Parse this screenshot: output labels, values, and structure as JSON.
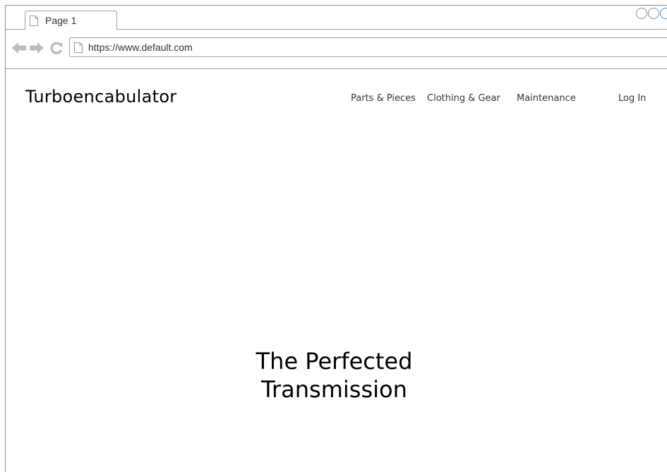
{
  "browser": {
    "tab_title": "Page 1",
    "url": "https://www.default.com",
    "icons": {
      "back": "arrow-left-icon",
      "forward": "arrow-right-icon",
      "reload": "reload-icon",
      "page": "page-icon"
    },
    "colors": {
      "chrome_border": "#a0a0a0",
      "nav_icon": "#bdbdbd",
      "active_control": "#2f9be0"
    }
  },
  "header": {
    "site_title": "Turboencabulator",
    "nav": [
      {
        "label": "Parts & Pieces"
      },
      {
        "label": "Clothing & Gear"
      },
      {
        "label": "Maintenance"
      }
    ],
    "login_label": "Log In"
  },
  "hero": {
    "line1": "The Perfected",
    "line2": "Transmission"
  }
}
